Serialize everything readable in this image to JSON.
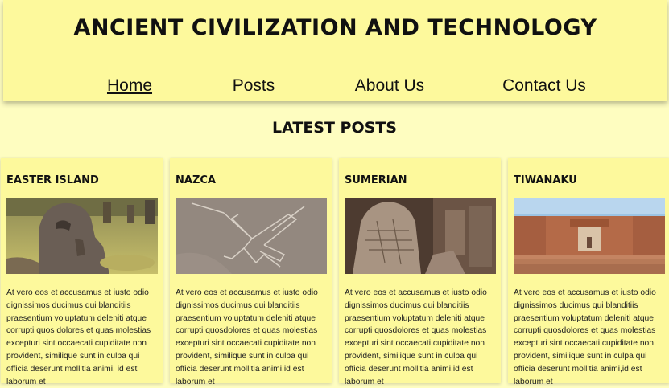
{
  "site": {
    "title": "Ancient Civilization and Technology"
  },
  "nav": [
    {
      "label": "Home",
      "active": true
    },
    {
      "label": "Posts",
      "active": false
    },
    {
      "label": "About Us",
      "active": false
    },
    {
      "label": "Contact Us",
      "active": false
    }
  ],
  "section": {
    "title": "Latest Posts"
  },
  "posts": [
    {
      "title": "Easter Island",
      "image": "easter-island-moai-photo",
      "excerpt": "At vero eos et accusamus et iusto odio dignissimos ducimus qui blanditiis praesentium voluptatum deleniti atque corrupti quos dolores et quas molestias excepturi sint occaecati cupiditate non provident, similique sunt in culpa qui officia deserunt mollitia animi, id est laborum et"
    },
    {
      "title": "Nazca",
      "image": "nazca-lines-hummingbird-photo",
      "excerpt": "At vero eos et accusamus et iusto odio dignissimos ducimus qui blanditiis praesentium voluptatum deleniti atque corrupti quosdolores et quas molestias excepturi sint occaecati cupiditate non provident, similique sunt in culpa qui officia deserunt mollitia animi,id est laborum et"
    },
    {
      "title": "Sumerian",
      "image": "sumerian-carved-stone-photo",
      "excerpt": "At vero eos et accusamus et iusto odio dignissimos ducimus qui blanditiis praesentium voluptatum deleniti atque corrupti quosdolores et quas molestias excepturi sint occaecati cupiditate non provident, similique sunt in culpa qui officia deserunt mollitia animi,id est laborum et"
    },
    {
      "title": "Tiwanaku",
      "image": "tiwanaku-stone-gateway-photo",
      "excerpt": "At vero eos et accusamus et iusto odio dignissimos ducimus qui blanditiis praesentium voluptatum deleniti atque corrupti quosdolores et quas molestias excepturi sint occaecati cupiditate non provident, similique sunt in culpa qui officia deserunt mollitia animi,id est laborum et"
    }
  ],
  "colors": {
    "page_bg": "#fefdc0",
    "header_bg": "#fdf99c",
    "card_bg": "#fdf99c",
    "text": "#111111"
  }
}
